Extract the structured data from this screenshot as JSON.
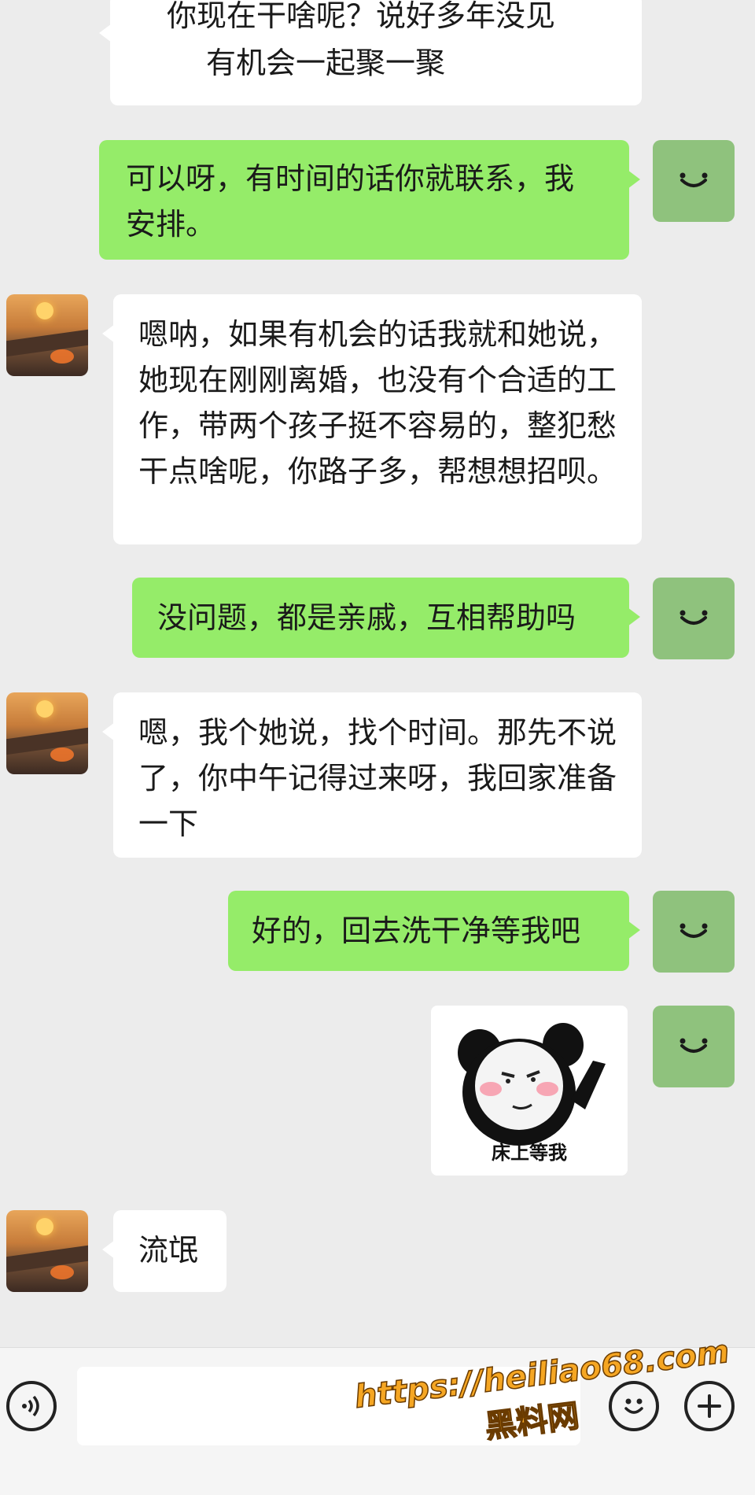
{
  "messages": [
    {
      "side": "in",
      "lines": [
        "你现在干啥呢？说好多年没见",
        "有机会一起聚一聚"
      ]
    },
    {
      "side": "out",
      "text": "可以呀，有时间的话你就联系，我安排。"
    },
    {
      "side": "in",
      "text": "嗯呐，如果有机会的话我就和她说，她现在刚刚离婚，也没有个合适的工作，带两个孩子挺不容易的，整犯愁干点啥呢，你路子多，帮想想招呗。"
    },
    {
      "side": "out",
      "text": "没问题，都是亲戚，互相帮助吗"
    },
    {
      "side": "in",
      "text": "嗯，我个她说，找个时间。那先不说了，你中午记得过来呀，我回家准备一下"
    },
    {
      "side": "out",
      "text": "好的，回去洗干净等我吧"
    },
    {
      "side": "out",
      "sticker_caption": "床上等我"
    },
    {
      "side": "in",
      "text": "流氓"
    }
  ],
  "input_bar": {
    "voice_icon": "voice-icon",
    "emoji_icon": "emoji-icon",
    "plus_icon": "plus-icon",
    "text_value": ""
  },
  "watermark": {
    "url": "https://heiliao68.com",
    "name": "黑料网"
  },
  "colors": {
    "background": "#ececec",
    "outgoing_bubble": "#95ec69",
    "incoming_bubble": "#ffffff",
    "self_avatar": "#8fc27d",
    "watermark": "#f5a623"
  }
}
